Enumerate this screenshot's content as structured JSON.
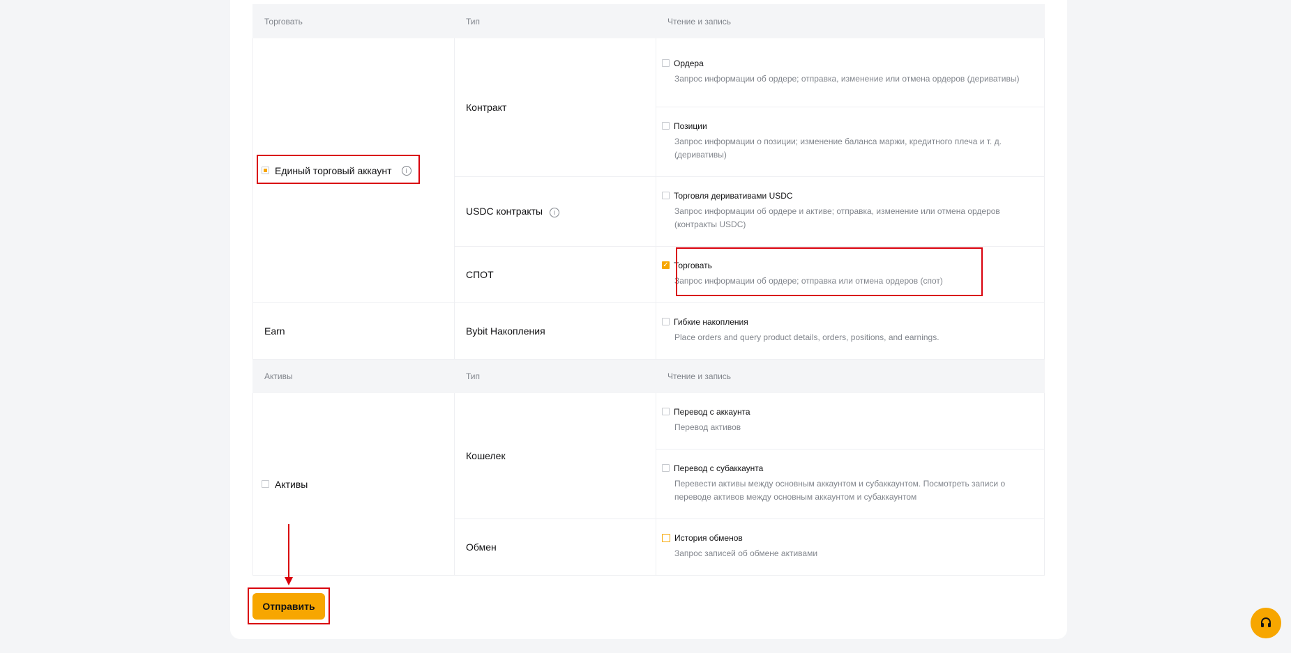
{
  "table": {
    "header1": {
      "col1": "Торговать",
      "col2": "Тип",
      "col3": "Чтение и запись"
    },
    "header2": {
      "col1": "Активы",
      "col2": "Тип",
      "col3": "Чтение и запись"
    },
    "unified": {
      "label": "Единый торговый аккаунт",
      "checkbox_state": "partial",
      "contract": {
        "type": "Контракт",
        "orders": {
          "title": "Ордера",
          "desc": "Запрос информации об ордере; отправка, изменение или отмена ордеров (деривативы)"
        },
        "positions": {
          "title": "Позиции",
          "desc": "Запрос информации о позиции; изменение баланса маржи, кредитного плеча и т. д. (деривативы)"
        }
      },
      "usdc": {
        "type": "USDC контракты",
        "trade": {
          "title": "Торговля деривативами USDC",
          "desc": "Запрос информации об ордере и активе; отправка, изменение или отмена ордеров (контракты USDC)"
        }
      },
      "spot": {
        "type": "СПОТ",
        "trade": {
          "title": "Торговать",
          "desc": "Запрос информации об ордере; отправка или отмена ордеров (спот)",
          "checked": true
        }
      }
    },
    "earn": {
      "label": "Earn",
      "type": "Bybit Накопления",
      "flexible": {
        "title": "Гибкие накопления",
        "desc": "Place orders and query product details, orders, positions, and earnings."
      }
    },
    "assets": {
      "label": "Активы",
      "wallet": {
        "type": "Кошелек",
        "account_transfer": {
          "title": "Перевод с аккаунта",
          "desc": "Перевод активов"
        },
        "subaccount_transfer": {
          "title": "Перевод с субаккаунта",
          "desc": "Перевести активы между основным аккаунтом и субаккаунтом. Посмотреть записи о переводе активов между основным аккаунтом и субаккаунтом"
        }
      },
      "exchange": {
        "type": "Обмен",
        "history": {
          "title": "История обменов",
          "desc": "Запрос записей об обмене активами"
        }
      }
    }
  },
  "submit_label": "Отправить",
  "icons": {
    "info": "info-icon",
    "check": "check-icon",
    "support": "headset-icon"
  },
  "colors": {
    "accent": "#f7a600",
    "annotation": "#d9000c"
  }
}
